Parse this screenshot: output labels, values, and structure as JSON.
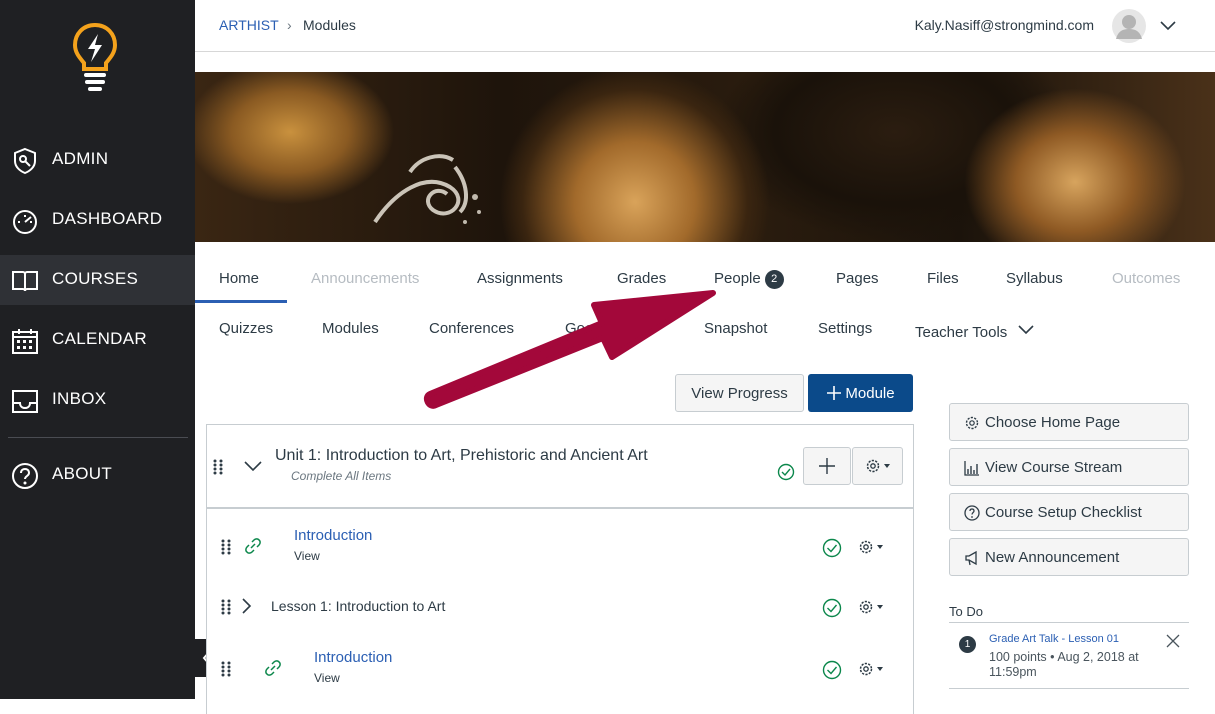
{
  "sidebar": {
    "items": [
      {
        "label": "ADMIN",
        "icon": "admin-shield-icon"
      },
      {
        "label": "DASHBOARD",
        "icon": "dashboard-gauge-icon"
      },
      {
        "label": "COURSES",
        "icon": "courses-book-icon",
        "active": true
      },
      {
        "label": "CALENDAR",
        "icon": "calendar-icon"
      },
      {
        "label": "INBOX",
        "icon": "inbox-tray-icon"
      },
      {
        "label": "ABOUT",
        "icon": "help-circle-icon"
      }
    ],
    "logo_icon": "lightbulb-logo-icon",
    "accent_color": "#f4a21c"
  },
  "header": {
    "breadcrumb": {
      "course": "ARTHIST",
      "separator": "›",
      "current": "Modules"
    },
    "user_email": "Kaly.Nasiff@strongmind.com"
  },
  "course_nav": {
    "row1": [
      {
        "label": "Home",
        "active": true
      },
      {
        "label": "Announcements",
        "disabled": true
      },
      {
        "label": "Assignments"
      },
      {
        "label": "Grades"
      },
      {
        "label": "People",
        "badge": "2"
      },
      {
        "label": "Pages"
      },
      {
        "label": "Files"
      },
      {
        "label": "Syllabus"
      },
      {
        "label": "Outcomes",
        "disabled": true
      }
    ],
    "row2": [
      {
        "label": "Quizzes"
      },
      {
        "label": "Modules"
      },
      {
        "label": "Conferences"
      },
      {
        "label": "Goo"
      },
      {
        "label": "Snapshot"
      },
      {
        "label": "Settings"
      },
      {
        "label": "Teacher Tools"
      }
    ]
  },
  "toolbar": {
    "view_progress": "View Progress",
    "add_module": "Module"
  },
  "module": {
    "title": "Unit 1: Introduction to Art, Prehistoric and Ancient Art",
    "requirement": "Complete All Items",
    "items": [
      {
        "title": "Introduction",
        "subtitle": "View"
      },
      {
        "lesson": "Lesson 1: Introduction to Art"
      },
      {
        "title": "Introduction",
        "subtitle": "View"
      }
    ]
  },
  "right_sidebar": {
    "buttons": [
      {
        "label": "Choose Home Page"
      },
      {
        "label": "View Course Stream"
      },
      {
        "label": "Course Setup Checklist"
      },
      {
        "label": "New Announcement"
      }
    ],
    "todo": {
      "heading": "To Do",
      "items": [
        {
          "number": "1",
          "title": "Grade Art Talk - Lesson 01",
          "meta": "100 points • Aug 2, 2018 at 11:59pm"
        }
      ]
    }
  },
  "colors": {
    "link": "#2b5fb3",
    "primary_button": "#0b4a8a",
    "success": "#0b874b",
    "annotation_arrow": "#a3083a"
  }
}
